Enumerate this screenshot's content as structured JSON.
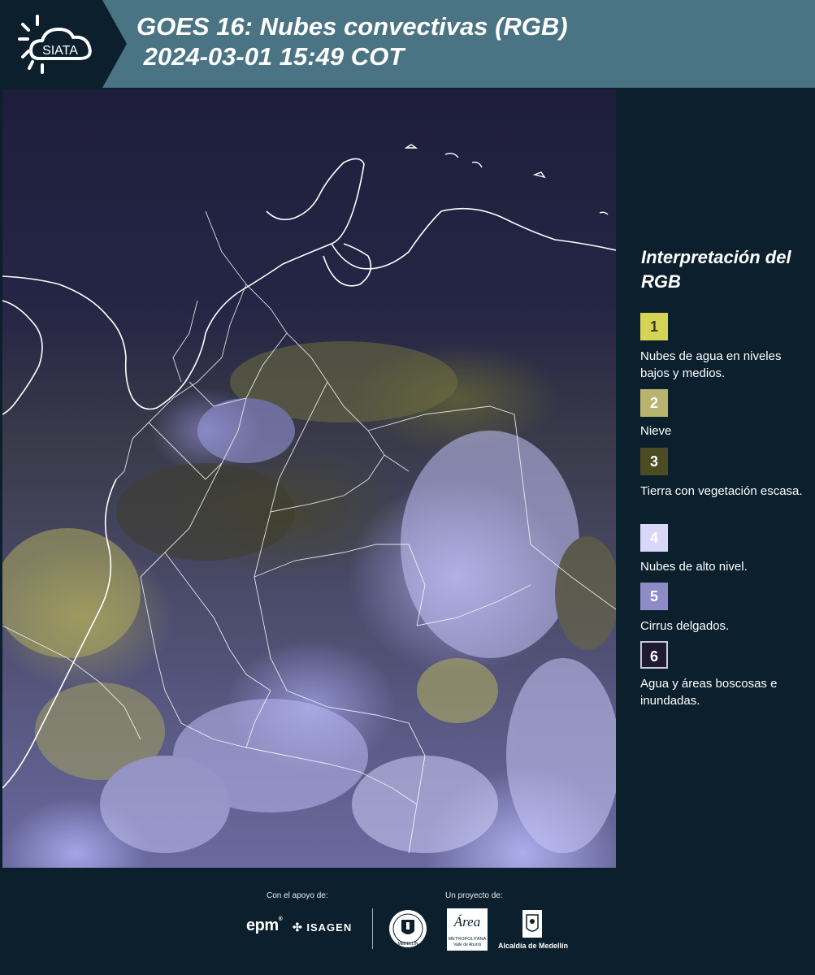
{
  "header": {
    "logo_text": "SIATA",
    "title_line1": "GOES 16: Nubes convectivas (RGB)",
    "title_line2": " 2024-03-01 15:49 COT"
  },
  "legend": {
    "title": "Interpretación del RGB",
    "items": [
      {
        "number": "1",
        "label": "Nubes de agua en niveles bajos y medios.",
        "color": "#d6d456"
      },
      {
        "number": "2",
        "label": "Nieve",
        "color": "#b8b46e"
      },
      {
        "number": "3",
        "label": "Tierra con vegetación escasa.",
        "color": "#4d4b22"
      },
      {
        "number": "4",
        "label": "Nubes de alto nivel.",
        "color": "#d8d7f7"
      },
      {
        "number": "5",
        "label": "Cirrus delgados.",
        "color": "#8d8cc9"
      },
      {
        "number": "6",
        "label": "Agua y áreas boscosas e inundadas.",
        "color": "#201b33"
      }
    ]
  },
  "footer": {
    "support_label": "Con el apoyo de:",
    "project_label": "Un proyecto de:",
    "sponsors": {
      "epm": "epm",
      "isagen": "ISAGEN",
      "area_metropolitana": "Área",
      "area_sub1": "METROPOLITANA",
      "area_sub2": "Valle de Aburrá",
      "alcaldia": "Alcaldía de Medellín",
      "seal": "MEDELLÍN"
    }
  },
  "colors": {
    "background": "#0b1f2c",
    "header_band": "#4a7384"
  }
}
